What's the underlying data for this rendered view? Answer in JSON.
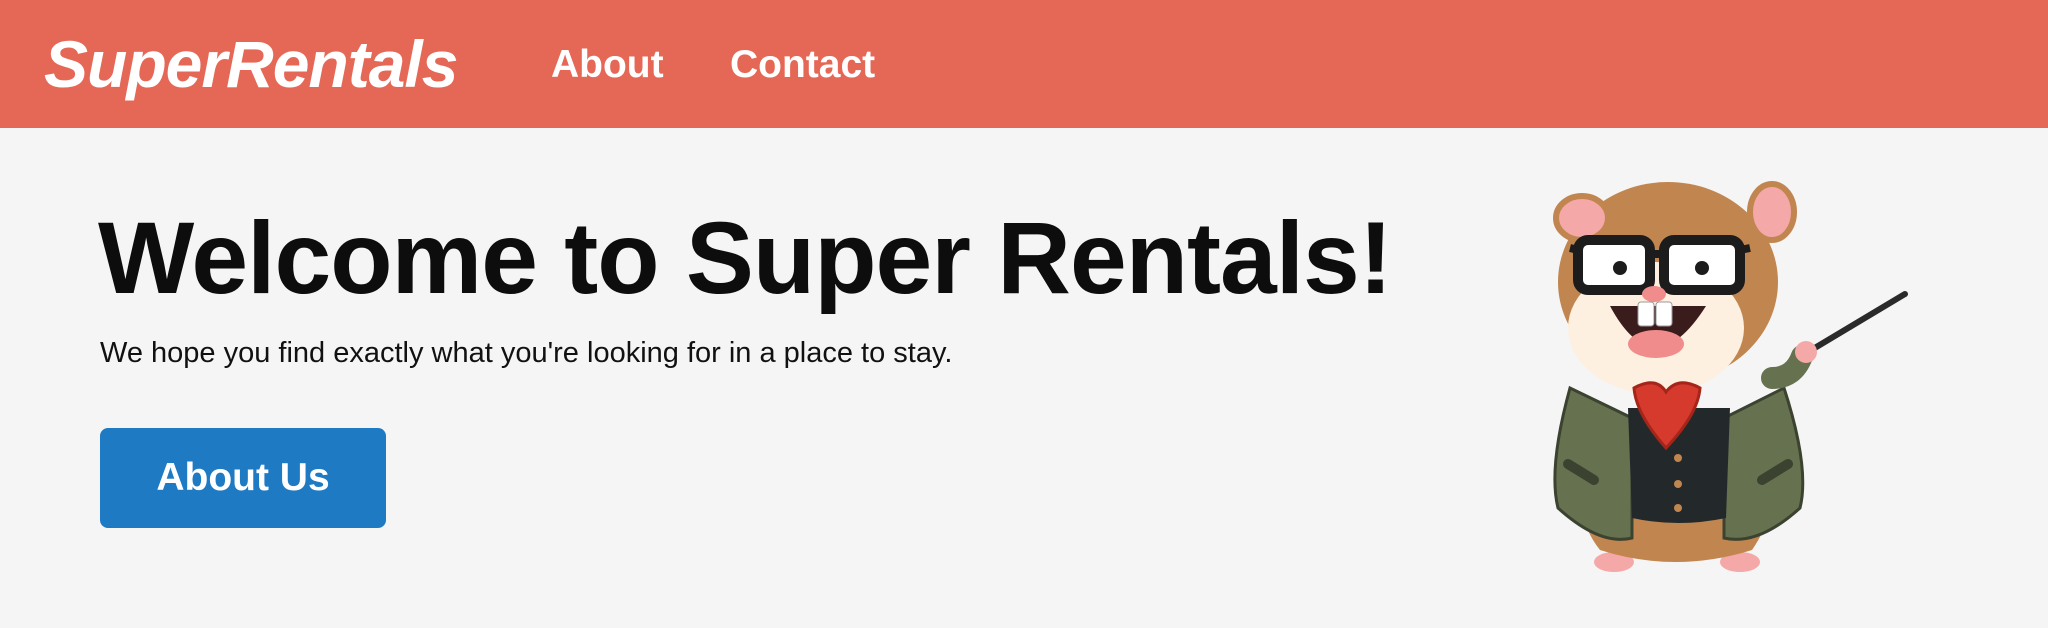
{
  "navbar": {
    "brand": "SuperRentals",
    "links": [
      {
        "label": "About"
      },
      {
        "label": "Contact"
      }
    ],
    "background_color": "#e56857"
  },
  "hero": {
    "title": "Welcome to Super Rentals!",
    "subtitle": "We hope you find exactly what you're looking for in a place to stay.",
    "button_label": "About Us",
    "button_color": "#1f7ac4"
  },
  "mascot": {
    "icon": "tomster-teacher-mascot-illustration"
  }
}
